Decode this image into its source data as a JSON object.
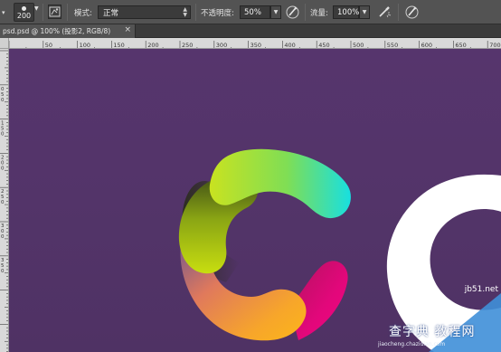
{
  "options_bar": {
    "brush_size": "200",
    "mode_label": "模式:",
    "mode_value": "正常",
    "opacity_label": "不透明度:",
    "opacity_value": "50%",
    "flow_label": "流量:",
    "flow_value": "100%",
    "icons": [
      "brush-preset-arrow-icon",
      "brush-panel-icon",
      "pressure-opacity-icon",
      "airbrush-icon",
      "pressure-size-icon"
    ]
  },
  "document": {
    "tab_title": "psd.psd @ 100% (投影2, RGB/8)",
    "tab_close": "×"
  },
  "rulers": {
    "top_labels": [
      "50",
      "100",
      "150",
      "200",
      "250",
      "300",
      "350",
      "400",
      "450",
      "500",
      "550",
      "600",
      "650",
      "700"
    ],
    "left_labels": [
      "0",
      "5",
      "0",
      "1",
      "5",
      "0",
      "2",
      "0",
      "0",
      "2",
      "5",
      "0",
      "3",
      "0",
      "0",
      "3",
      "5",
      "0"
    ]
  },
  "canvas": {
    "background": "#54346a",
    "ring_colors": [
      "#c6e41e",
      "#2fdfd6",
      "#e6097a",
      "#f7b51a",
      "#7a8f10"
    ]
  },
  "watermark": {
    "site": "jb51.net",
    "text": "查字典 教程网",
    "url": "jiaocheng.chazidian.com"
  }
}
